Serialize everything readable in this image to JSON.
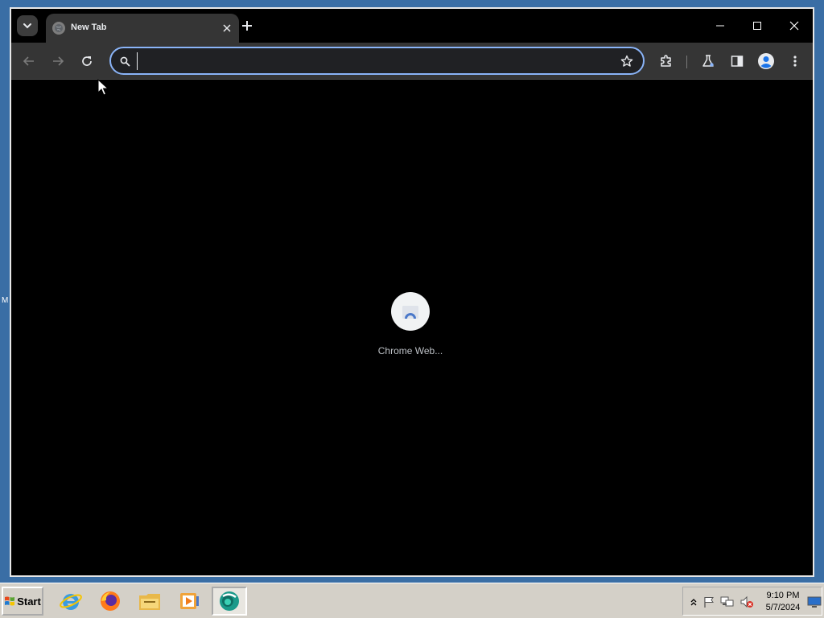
{
  "desktop": {
    "edge_letter": "M"
  },
  "browser": {
    "tab": {
      "title": "New Tab"
    },
    "omnibox": {
      "value": "",
      "placeholder": ""
    },
    "new_tab_page": {
      "shortcuts": [
        {
          "label": "Chrome Web..."
        }
      ]
    },
    "colors": {
      "frame": "#000000",
      "toolbar": "#353535",
      "omnibox_focus_ring": "#8ab4f8",
      "shortcut_label": "#bdc1c6"
    }
  },
  "taskbar": {
    "start_label": "Start",
    "apps": [
      {
        "name": "internet-explorer-icon"
      },
      {
        "name": "firefox-icon"
      },
      {
        "name": "file-explorer-icon"
      },
      {
        "name": "media-player-icon"
      },
      {
        "name": "chrome-app-icon",
        "active": true
      }
    ],
    "clock": {
      "time": "9:10 PM",
      "date": "5/7/2024"
    }
  }
}
